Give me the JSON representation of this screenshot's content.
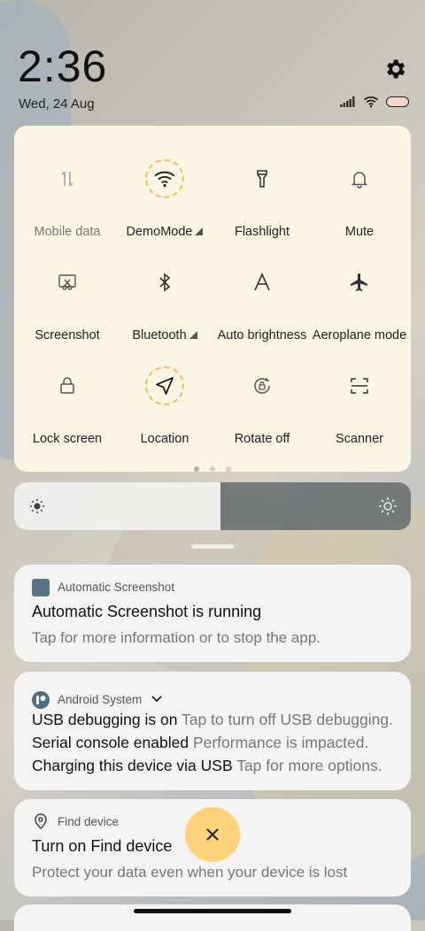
{
  "status": {
    "time": "2:36",
    "date": "Wed, 24 Aug"
  },
  "quick_settings": {
    "tiles": [
      {
        "label": "Mobile data",
        "icon": "mobile-data-icon",
        "active": false,
        "dim": true
      },
      {
        "label": "DemoMode",
        "icon": "wifi-icon",
        "active": true,
        "expandable": true
      },
      {
        "label": "Flashlight",
        "icon": "flashlight-icon",
        "active": false
      },
      {
        "label": "Mute",
        "icon": "bell-icon",
        "active": false
      },
      {
        "label": "Screenshot",
        "icon": "screenshot-icon",
        "active": false
      },
      {
        "label": "Bluetooth",
        "icon": "bluetooth-icon",
        "active": false,
        "expandable": true
      },
      {
        "label": "Auto brightness",
        "icon": "auto-brightness-icon",
        "active": false
      },
      {
        "label": "Aeroplane mode",
        "icon": "airplane-icon",
        "active": false
      },
      {
        "label": "Lock screen",
        "icon": "lock-icon",
        "active": false
      },
      {
        "label": "Location",
        "icon": "location-icon",
        "active": true
      },
      {
        "label": "Rotate off",
        "icon": "rotate-lock-icon",
        "active": false
      },
      {
        "label": "Scanner",
        "icon": "scanner-icon",
        "active": false
      }
    ],
    "page_count": 3,
    "current_page": 0
  },
  "brightness": {
    "level": 0.52
  },
  "notifications": {
    "screenshot": {
      "app": "Automatic Screenshot",
      "title": "Automatic Screenshot is running",
      "body": "Tap for more information or to stop the app."
    },
    "android": {
      "app": "Android System",
      "rows": [
        {
          "title": "USB debugging is on",
          "sub": "Tap to turn off USB debugging."
        },
        {
          "title": "Serial console enabled",
          "sub": "Performance is impacted."
        },
        {
          "title": "Charging this device via USB",
          "sub": "Tap for more options."
        }
      ]
    },
    "find": {
      "app": "Find device",
      "title": "Turn on Find device",
      "body": "Protect your data even when your device is lost"
    }
  },
  "colors": {
    "panel": "#fdf5e4",
    "accent": "#f2bd5d",
    "fab": "#fdd27a"
  }
}
